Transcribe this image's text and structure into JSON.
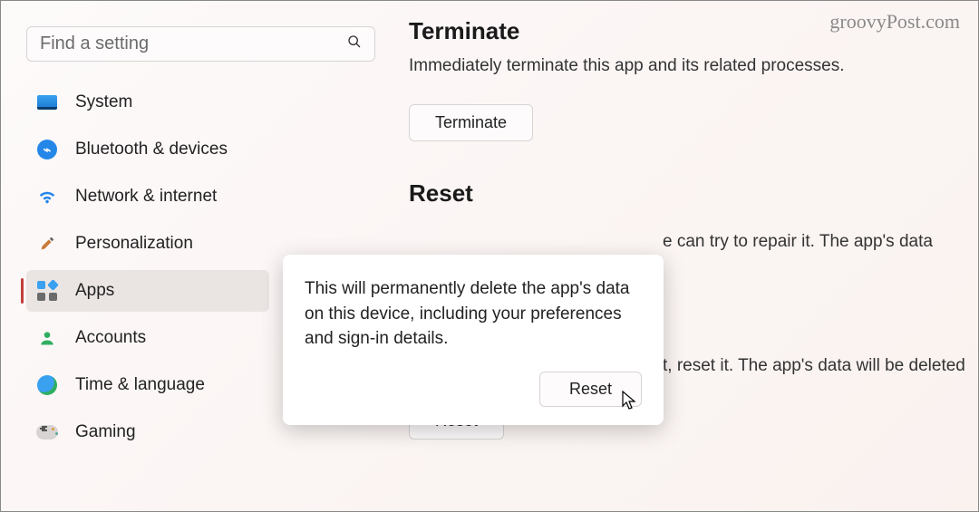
{
  "watermark": "groovyPost.com",
  "search": {
    "placeholder": "Find a setting"
  },
  "sidebar": {
    "items": [
      {
        "label": "System"
      },
      {
        "label": "Bluetooth & devices"
      },
      {
        "label": "Network & internet"
      },
      {
        "label": "Personalization"
      },
      {
        "label": "Apps"
      },
      {
        "label": "Accounts"
      },
      {
        "label": "Time & language"
      },
      {
        "label": "Gaming"
      }
    ]
  },
  "main": {
    "terminate": {
      "title": "Terminate",
      "desc": "Immediately terminate this app and its related processes.",
      "button": "Terminate"
    },
    "reset": {
      "title": "Reset",
      "partial1": "e can try to repair it. The app's data",
      "partial2": "t, reset it. The app's data will be deleted",
      "button": "Reset"
    }
  },
  "popup": {
    "text": "This will permanently delete the app's data on this device, including your preferences and sign-in details.",
    "button": "Reset"
  }
}
